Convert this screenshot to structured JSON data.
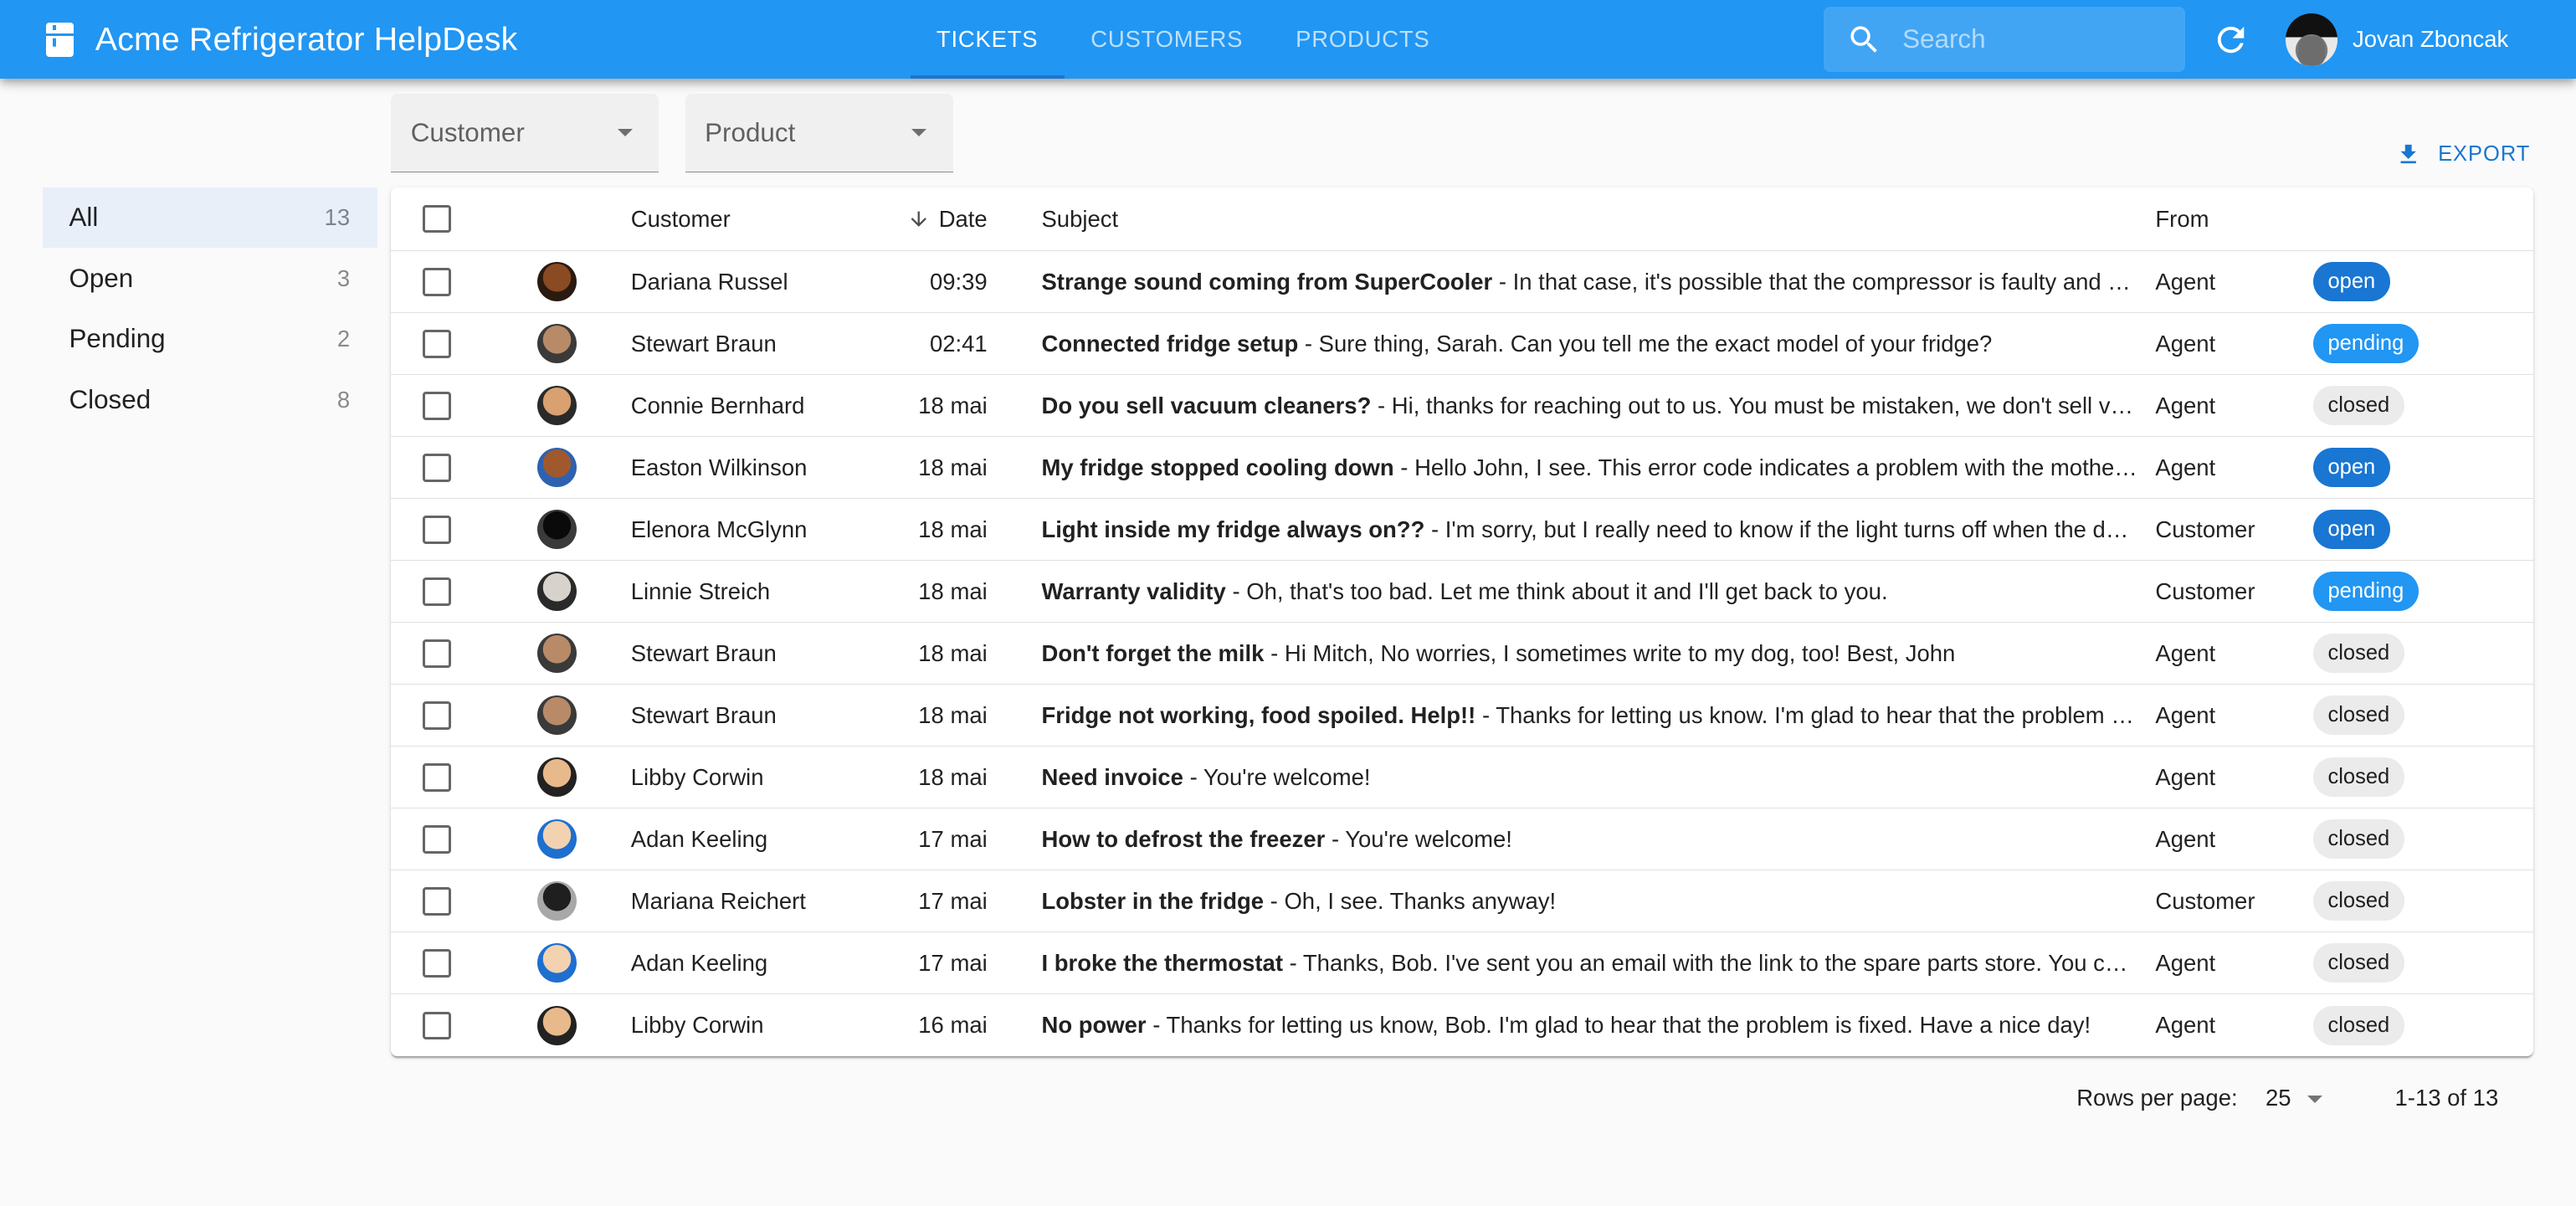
{
  "app": {
    "title": "Acme Refrigerator HelpDesk",
    "brand_icon": "fridge-icon"
  },
  "nav": {
    "tabs": [
      {
        "label": "TICKETS",
        "active": true
      },
      {
        "label": "CUSTOMERS",
        "active": false
      },
      {
        "label": "PRODUCTS",
        "active": false
      }
    ]
  },
  "search": {
    "placeholder": "Search",
    "value": "",
    "icon": "search-icon"
  },
  "toolbar": {
    "refresh_icon": "refresh-icon"
  },
  "user": {
    "name": "Jovan Zboncak"
  },
  "sidebar": {
    "items": [
      {
        "label": "All",
        "count": "13",
        "active": true
      },
      {
        "label": "Open",
        "count": "3",
        "active": false
      },
      {
        "label": "Pending",
        "count": "2",
        "active": false
      },
      {
        "label": "Closed",
        "count": "8",
        "active": false
      }
    ]
  },
  "filters": {
    "customer": {
      "label": "Customer",
      "value": ""
    },
    "product": {
      "label": "Product",
      "value": ""
    }
  },
  "actions": {
    "export_label": "EXPORT"
  },
  "colors": {
    "primary": "#2196f3",
    "primary_dark": "#1976d2",
    "status_open": "#1976d2",
    "status_pending": "#2196f3",
    "status_closed": "#ebebeb"
  },
  "table": {
    "columns": {
      "customer": "Customer",
      "date": "Date",
      "subject": "Subject",
      "from": "From"
    },
    "sort": {
      "column": "date",
      "direction": "desc"
    },
    "rows": [
      {
        "customer": "Dariana Russel",
        "date": "09:39",
        "subject": "Strange sound coming from SuperCooler",
        "excerpt": " - In that case, it's possible that the compressor is faulty and needs ...",
        "from": "Agent",
        "status": "open",
        "avatar_colors": [
          "#8a4a22",
          "#2a1a10"
        ]
      },
      {
        "customer": "Stewart Braun",
        "date": "02:41",
        "subject": "Connected fridge setup",
        "excerpt": " - Sure thing, Sarah. Can you tell me the exact model of your fridge?",
        "from": "Agent",
        "status": "pending",
        "avatar_colors": [
          "#b88a68",
          "#3a3a3a"
        ]
      },
      {
        "customer": "Connie Bernhard",
        "date": "18 mai",
        "subject": "Do you sell vacuum cleaners?",
        "excerpt": " - Hi, thanks for reaching out to us. You must be mistaken, we don't sell vacuu...",
        "from": "Agent",
        "status": "closed",
        "avatar_colors": [
          "#d9a070",
          "#2a2a2a"
        ]
      },
      {
        "customer": "Easton Wilkinson",
        "date": "18 mai",
        "subject": "My fridge stopped cooling down",
        "excerpt": " - Hello John, I see. This error code indicates a problem with the motherboar...",
        "from": "Agent",
        "status": "open",
        "avatar_colors": [
          "#a0592d",
          "#2e62b0"
        ]
      },
      {
        "customer": "Elenora McGlynn",
        "date": "18 mai",
        "subject": "Light inside my fridge always on??",
        "excerpt": " - I'm sorry, but I really need to know if the light turns off when the door is ...",
        "from": "Customer",
        "status": "open",
        "avatar_colors": [
          "#0a0a0a",
          "#3a3a3a"
        ]
      },
      {
        "customer": "Linnie Streich",
        "date": "18 mai",
        "subject": "Warranty validity",
        "excerpt": " - Oh, that's too bad. Let me think about it and I'll get back to you.",
        "from": "Customer",
        "status": "pending",
        "avatar_colors": [
          "#d8d2cc",
          "#2a2a2a"
        ]
      },
      {
        "customer": "Stewart Braun",
        "date": "18 mai",
        "subject": "Don't forget the milk",
        "excerpt": " - Hi Mitch, No worries, I sometimes write to my dog, too! Best, John",
        "from": "Agent",
        "status": "closed",
        "avatar_colors": [
          "#b88a68",
          "#3a3a3a"
        ]
      },
      {
        "customer": "Stewart Braun",
        "date": "18 mai",
        "subject": "Fridge not working, food spoiled. Help!!",
        "excerpt": " - Thanks for letting us know. I'm glad to hear that the problem is fixe...",
        "from": "Agent",
        "status": "closed",
        "avatar_colors": [
          "#b88a68",
          "#3a3a3a"
        ]
      },
      {
        "customer": "Libby Corwin",
        "date": "18 mai",
        "subject": "Need invoice",
        "excerpt": " - You're welcome!",
        "from": "Agent",
        "status": "closed",
        "avatar_colors": [
          "#e8b98a",
          "#222222"
        ]
      },
      {
        "customer": "Adan Keeling",
        "date": "17 mai",
        "subject": "How to defrost the freezer",
        "excerpt": " - You're welcome!",
        "from": "Agent",
        "status": "closed",
        "avatar_colors": [
          "#f2d2b0",
          "#1e6fd0"
        ]
      },
      {
        "customer": "Mariana Reichert",
        "date": "17 mai",
        "subject": "Lobster in the fridge",
        "excerpt": " - Oh, I see. Thanks anyway!",
        "from": "Customer",
        "status": "closed",
        "avatar_colors": [
          "#1f1f1f",
          "#a8a8a8"
        ]
      },
      {
        "customer": "Adan Keeling",
        "date": "17 mai",
        "subject": "I broke the thermostat",
        "excerpt": " - Thanks, Bob. I've sent you an email with the link to the spare parts store. You can bu...",
        "from": "Agent",
        "status": "closed",
        "avatar_colors": [
          "#f2d2b0",
          "#1e6fd0"
        ]
      },
      {
        "customer": "Libby Corwin",
        "date": "16 mai",
        "subject": "No power",
        "excerpt": " - Thanks for letting us know, Bob. I'm glad to hear that the problem is fixed. Have a nice day!",
        "from": "Agent",
        "status": "closed",
        "avatar_colors": [
          "#e8b98a",
          "#222222"
        ]
      }
    ]
  },
  "pagination": {
    "rows_per_page_label": "Rows per page:",
    "rows_per_page": "25",
    "range": "1-13 of 13"
  }
}
